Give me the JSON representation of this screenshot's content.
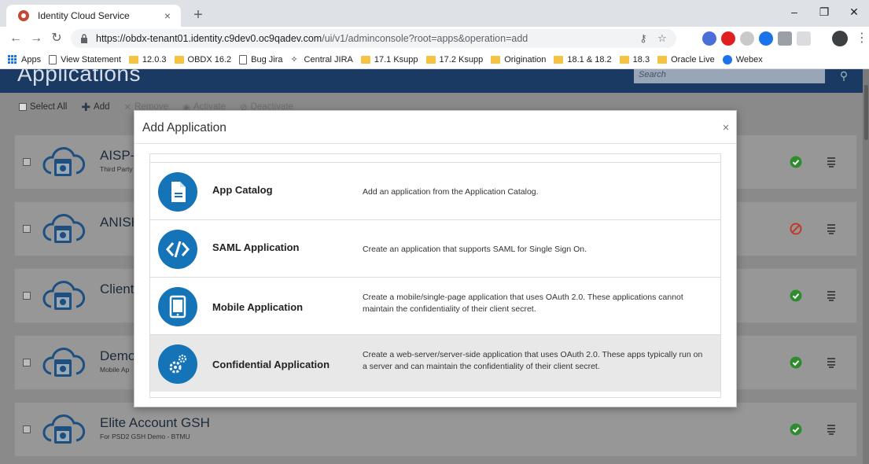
{
  "browser": {
    "tab_title": "Identity Cloud Service",
    "url_host": "https://obdx-tenant01.identity.c9dev0.oc9qadev.com",
    "url_path": "/ui/v1/adminconsole?root=apps&operation=add",
    "bookmarks": [
      {
        "label": "Apps",
        "icon": "apps-icon"
      },
      {
        "label": "View Statement",
        "icon": "page-icon"
      },
      {
        "label": "12.0.3",
        "icon": "folder-icon"
      },
      {
        "label": "OBDX 16.2",
        "icon": "folder-icon"
      },
      {
        "label": "Bug Jira",
        "icon": "page-icon"
      },
      {
        "label": "Central JIRA",
        "icon": "award-icon"
      },
      {
        "label": "17.1 Ksupp",
        "icon": "folder-icon"
      },
      {
        "label": "17.2 Ksupp",
        "icon": "folder-icon"
      },
      {
        "label": "Origination",
        "icon": "folder-icon"
      },
      {
        "label": "18.1 & 18.2",
        "icon": "folder-icon"
      },
      {
        "label": "18.3",
        "icon": "folder-icon"
      },
      {
        "label": "Oracle Live",
        "icon": "folder-icon"
      },
      {
        "label": "Webex",
        "icon": "globe-icon"
      }
    ]
  },
  "app": {
    "title": "Applications",
    "search_placeholder": "Search",
    "actions": {
      "select_all": "Select All",
      "add": "Add",
      "remove": "Remove",
      "activate": "Activate",
      "deactivate": "Deactivate"
    },
    "rows": [
      {
        "name": "AISP-",
        "desc": "Third Party",
        "status": "active"
      },
      {
        "name": "ANISH",
        "desc": "",
        "status": "inactive"
      },
      {
        "name": "Client",
        "desc": "",
        "status": "active"
      },
      {
        "name": "Demo",
        "desc": "Mobile Ap",
        "status": "active"
      },
      {
        "name": "Elite Account GSH",
        "desc": "For PSD2 GSH Demo - BTMU",
        "status": "active"
      }
    ]
  },
  "modal": {
    "title": "Add Application",
    "close_glyph": "×",
    "options": [
      {
        "name": "App Catalog",
        "desc": "Add an application from the Application Catalog.",
        "icon": "document-icon"
      },
      {
        "name": "SAML Application",
        "desc": "Create an application that supports SAML for Single Sign On.",
        "icon": "code-icon"
      },
      {
        "name": "Mobile Application",
        "desc": "Create a mobile/single-page application that uses OAuth 2.0. These applications cannot maintain the confidentiality of their client secret.",
        "icon": "tablet-icon"
      },
      {
        "name": "Confidential Application",
        "desc": "Create a web-server/server-side application that uses OAuth 2.0. These apps typically run on a server and can maintain the confidentiality of their client secret.",
        "icon": "gears-icon"
      }
    ]
  },
  "colors": {
    "header": "#1b3a63",
    "accent": "#1574b8",
    "ok": "#2e8b2e",
    "error": "#c0392b"
  }
}
